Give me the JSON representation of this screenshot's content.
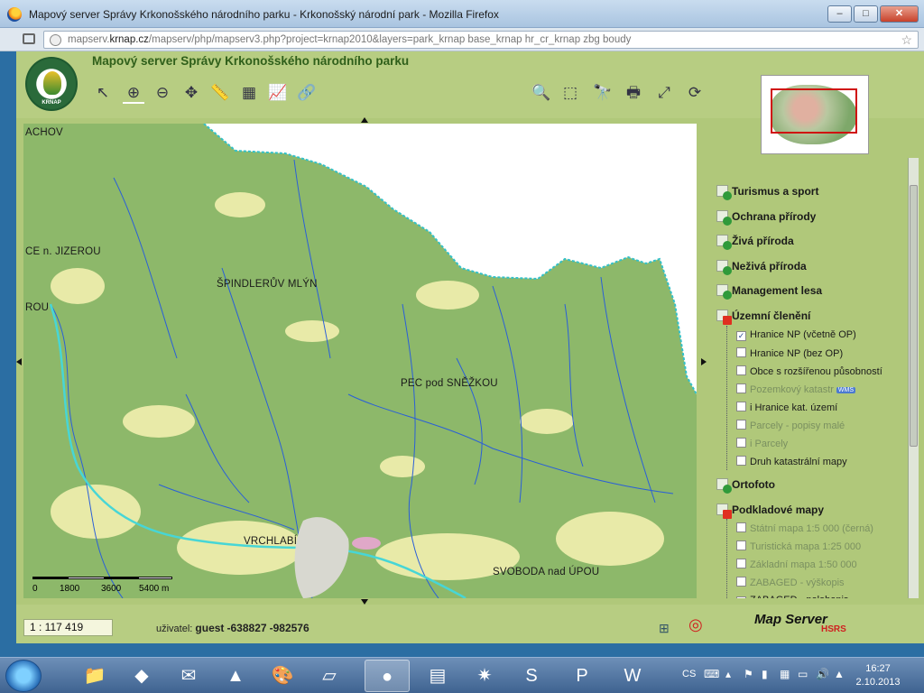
{
  "window": {
    "title": "Mapový server Správy Krkonošského národního parku - Krkonošský národní park - Mozilla Firefox",
    "min": "–",
    "max": "□",
    "close": "✕"
  },
  "address": {
    "url_prefix": "mapserv.",
    "url_domain": "krnap.cz",
    "url_rest": "/mapserv/php/mapserv3.php?project=krnap2010&layers=park_krnap base_krnap hr_cr_krnap zbg boudy",
    "star": "☆"
  },
  "app": {
    "title": "Mapový server Správy Krkonošského národního parku",
    "logo_text": "KRNAP",
    "tools": [
      {
        "name": "identify-tool",
        "glyph": "↖"
      },
      {
        "name": "zoom-in-tool",
        "glyph": "⊕"
      },
      {
        "name": "zoom-out-tool",
        "glyph": "⊖"
      },
      {
        "name": "pan-tool",
        "glyph": "✥"
      },
      {
        "name": "measure-tool",
        "glyph": "📏"
      },
      {
        "name": "table-tool",
        "glyph": "▦"
      },
      {
        "name": "profile-tool",
        "glyph": "📈"
      },
      {
        "name": "link-tool",
        "glyph": "🔗"
      }
    ],
    "right_tools": [
      {
        "name": "search-tool",
        "glyph": "🔍"
      },
      {
        "name": "clear-selection-tool",
        "glyph": "⬚"
      },
      {
        "name": "binoculars-tool",
        "glyph": "🔭"
      },
      {
        "name": "print-tool",
        "glyph": "🖶"
      },
      {
        "name": "full-extent-tool",
        "glyph": "⤢"
      },
      {
        "name": "refresh-tool",
        "glyph": "⟳"
      }
    ]
  },
  "map": {
    "labels": [
      {
        "text": "ACHOV"
      },
      {
        "text": "CE n. JIZEROU"
      },
      {
        "text": "ROU"
      },
      {
        "text": "ŠPINDLERŮV MLÝN"
      },
      {
        "text": "PEC pod SNĚŽKOU"
      },
      {
        "text": "VRCHLABÍ"
      },
      {
        "text": "SVOBODA nad ÚPOU"
      }
    ],
    "scalebar": [
      "0",
      "1800",
      "3600",
      "5400 m"
    ]
  },
  "legend": {
    "groups": [
      {
        "label": "Turismus a sport",
        "expanded": false
      },
      {
        "label": "Ochrana přírody",
        "expanded": false
      },
      {
        "label": "Živá příroda",
        "expanded": false
      },
      {
        "label": "Neživá příroda",
        "expanded": false
      },
      {
        "label": "Management lesa",
        "expanded": false
      },
      {
        "label": "Územní členění",
        "expanded": true
      },
      {
        "label": "Ortofoto",
        "expanded": false
      },
      {
        "label": "Podkladové mapy",
        "expanded": true
      }
    ],
    "uzemni_layers": [
      {
        "label": "Hranice NP (včetně OP)",
        "checked": true,
        "disabled": false
      },
      {
        "label": "Hranice NP (bez OP)",
        "checked": false,
        "disabled": false
      },
      {
        "label": "Obce s rozšířenou působností",
        "checked": false,
        "disabled": false
      },
      {
        "label": "Pozemkový katastr",
        "checked": false,
        "disabled": true,
        "wms": "WMS"
      },
      {
        "label": "i Hranice kat. území",
        "checked": false,
        "disabled": false
      },
      {
        "label": "Parcely - popisy malé",
        "checked": false,
        "disabled": true
      },
      {
        "label": "i Parcely",
        "checked": false,
        "disabled": true
      },
      {
        "label": "Druh katastrální mapy",
        "checked": false,
        "disabled": false
      }
    ],
    "podkladove_layers": [
      {
        "label": "Státní mapa 1:5 000 (černá)",
        "checked": false,
        "disabled": true
      },
      {
        "label": "Turistická mapa 1:25 000",
        "checked": false,
        "disabled": true
      },
      {
        "label": "Základní mapa 1:50 000",
        "checked": false,
        "disabled": true
      },
      {
        "label": "ZABAGED - výškopis",
        "checked": false,
        "disabled": true
      },
      {
        "label": "ZABAGED - polohopis",
        "checked": true,
        "disabled": false
      }
    ]
  },
  "footer": {
    "scale": "1 : 117 419",
    "user_label": "uživatel:",
    "user": "guest",
    "x": "-638827",
    "y": "-982576",
    "mapserver_logo": "Map Server",
    "hsrs_logo": "HSRS"
  },
  "taskbar": {
    "lang": "CS",
    "time": "16:27",
    "date": "2.10.2013"
  }
}
